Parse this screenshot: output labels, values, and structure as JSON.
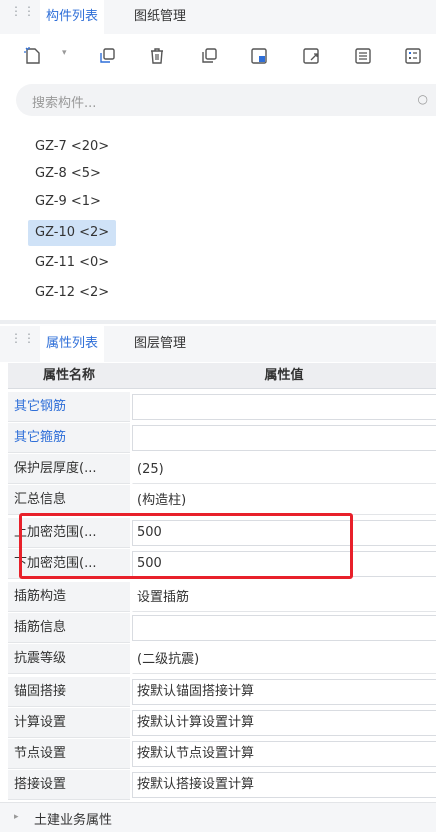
{
  "top_panel": {
    "tabs": [
      {
        "label": "构件列表"
      },
      {
        "label": "图纸管理"
      }
    ],
    "search_placeholder": "搜索构件...",
    "items": [
      {
        "label": "GZ-7 <20>"
      },
      {
        "label": "GZ-8 <5>"
      },
      {
        "label": "GZ-9 <1>"
      },
      {
        "label": "GZ-10 <2>"
      },
      {
        "label": "GZ-11 <0>"
      },
      {
        "label": "GZ-12 <2>"
      }
    ],
    "selected_item": "GZ-10 <2>"
  },
  "toolbar": {
    "buttons": [
      {
        "icon": "new-component-icon"
      },
      {
        "icon": "copy-icon"
      },
      {
        "icon": "delete-icon"
      },
      {
        "icon": "layer-copy-icon"
      },
      {
        "icon": "import-icon"
      },
      {
        "icon": "export-icon"
      },
      {
        "icon": "list-icon"
      },
      {
        "icon": "property-icon"
      }
    ]
  },
  "bottom_panel": {
    "tabs": [
      {
        "label": "属性列表"
      },
      {
        "label": "图层管理"
      }
    ],
    "header": {
      "name": "属性名称",
      "value": "属性值"
    },
    "rows": [
      {
        "name": "其它钢筋",
        "value": ""
      },
      {
        "name": "其它箍筋",
        "value": ""
      },
      {
        "name": "保护层厚度(...",
        "value": "(25)"
      },
      {
        "name": "汇总信息",
        "value": "(构造柱)"
      },
      {
        "name": "上加密范围(...",
        "value": "500"
      },
      {
        "name": "下加密范围(...",
        "value": "500"
      },
      {
        "name": "插筋构造",
        "value": "设置插筋"
      },
      {
        "name": "插筋信息",
        "value": ""
      },
      {
        "name": "抗震等级",
        "value": "(二级抗震)"
      },
      {
        "name": "锚固搭接",
        "value": "按默认锚固搭接计算"
      },
      {
        "name": "计算设置",
        "value": "按默认计算设置计算"
      },
      {
        "name": "节点设置",
        "value": "按默认节点设置计算"
      },
      {
        "name": "搭接设置",
        "value": "按默认搭接设置计算"
      }
    ],
    "footer_group": "土建业务属性"
  },
  "colors": {
    "accent": "#2f6fd8",
    "highlight": "#e8202a",
    "selection": "#cfe2f7"
  }
}
